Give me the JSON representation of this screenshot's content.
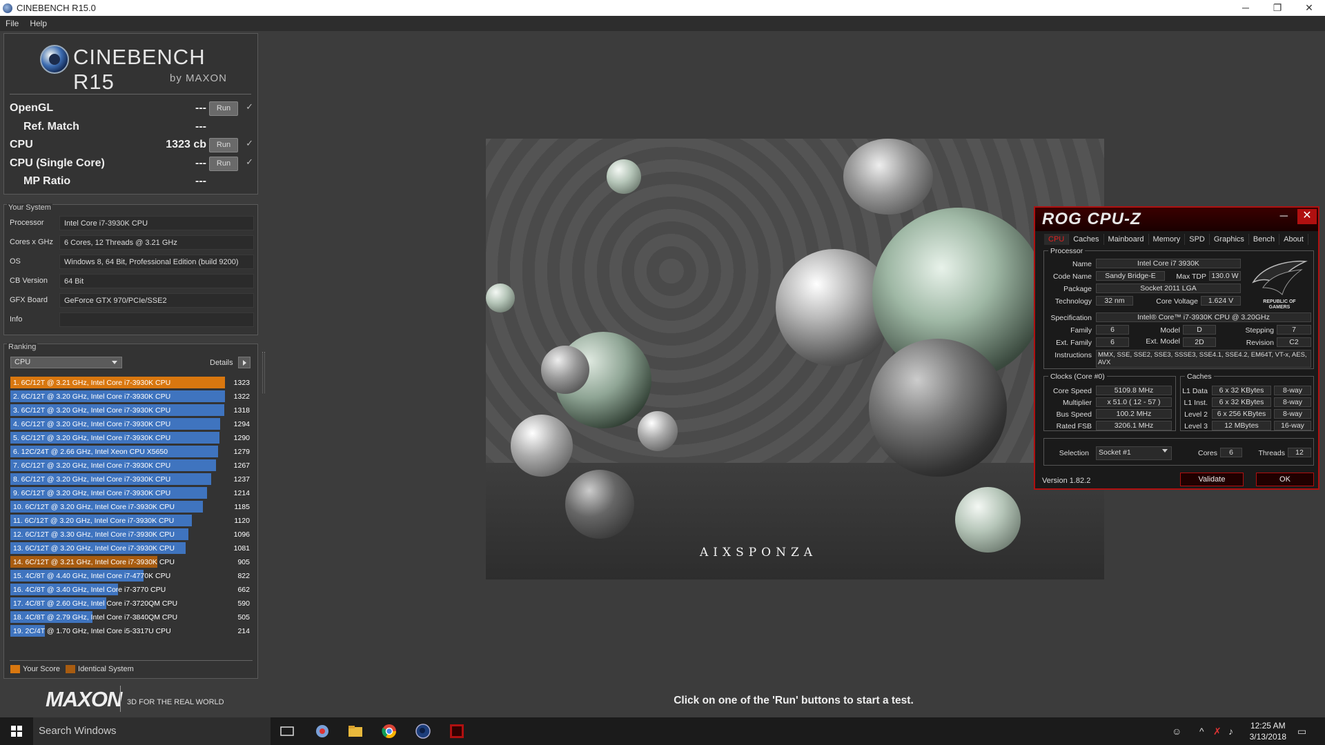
{
  "window": {
    "title": "CINEBENCH R15.0",
    "min": "─",
    "max": "❐",
    "close": "✕"
  },
  "menu": [
    "File",
    "Help"
  ],
  "logo": {
    "name": "CINEBENCH R15",
    "by": "by MAXON"
  },
  "benchmarks": [
    {
      "label": "OpenGL",
      "value": "---",
      "run": "Run",
      "check": "✓",
      "sub": false
    },
    {
      "label": "Ref. Match",
      "value": "---",
      "sub": true
    },
    {
      "label": "CPU",
      "value": "1323 cb",
      "run": "Run",
      "check": "✓",
      "sub": false
    },
    {
      "label": "CPU (Single Core)",
      "value": "---",
      "run": "Run",
      "check": "✓",
      "sub": false
    },
    {
      "label": "MP Ratio",
      "value": "---",
      "sub": true
    }
  ],
  "system": {
    "title": "Your System",
    "rows": [
      {
        "key": "Processor",
        "value": "Intel Core i7-3930K CPU"
      },
      {
        "key": "Cores x GHz",
        "value": "6 Cores, 12 Threads @ 3.21 GHz"
      },
      {
        "key": "OS",
        "value": "Windows 8, 64 Bit, Professional Edition (build 9200)"
      },
      {
        "key": "CB Version",
        "value": "64 Bit"
      },
      {
        "key": "GFX Board",
        "value": "GeForce GTX 970/PCIe/SSE2"
      },
      {
        "key": "Info",
        "value": ""
      }
    ]
  },
  "ranking": {
    "title": "Ranking",
    "selected": "CPU",
    "details": "Details",
    "max_score": 1323,
    "items": [
      {
        "label": "1. 6C/12T @ 3.21 GHz,  Intel Core i7-3930K CPU",
        "score": 1323,
        "kind": "your"
      },
      {
        "label": "2. 6C/12T @ 3.20 GHz,  Intel Core i7-3930K CPU",
        "score": 1322,
        "kind": "other"
      },
      {
        "label": "3. 6C/12T @ 3.20 GHz,  Intel Core i7-3930K CPU",
        "score": 1318,
        "kind": "other"
      },
      {
        "label": "4. 6C/12T @ 3.20 GHz,  Intel Core i7-3930K CPU",
        "score": 1294,
        "kind": "other"
      },
      {
        "label": "5. 6C/12T @ 3.20 GHz,  Intel Core i7-3930K CPU",
        "score": 1290,
        "kind": "other"
      },
      {
        "label": "6. 12C/24T @ 2.66 GHz, Intel Xeon CPU X5650",
        "score": 1279,
        "kind": "other"
      },
      {
        "label": "7. 6C/12T @ 3.20 GHz,  Intel Core i7-3930K CPU",
        "score": 1267,
        "kind": "other"
      },
      {
        "label": "8. 6C/12T @ 3.20 GHz,  Intel Core i7-3930K CPU",
        "score": 1237,
        "kind": "other"
      },
      {
        "label": "9. 6C/12T @ 3.20 GHz,  Intel Core i7-3930K CPU",
        "score": 1214,
        "kind": "other"
      },
      {
        "label": "10. 6C/12T @ 3.20 GHz,  Intel Core i7-3930K CPU",
        "score": 1185,
        "kind": "other"
      },
      {
        "label": "11. 6C/12T @ 3.20 GHz,  Intel Core i7-3930K CPU",
        "score": 1120,
        "kind": "other"
      },
      {
        "label": "12. 6C/12T @ 3.30 GHz,  Intel Core i7-3930K CPU",
        "score": 1096,
        "kind": "other"
      },
      {
        "label": "13. 6C/12T @ 3.20 GHz,  Intel Core i7-3930K CPU",
        "score": 1081,
        "kind": "other"
      },
      {
        "label": "14. 6C/12T @ 3.21 GHz,  Intel Core i7-3930K CPU",
        "score": 905,
        "kind": "identical"
      },
      {
        "label": "15. 4C/8T @ 4.40 GHz, Intel Core i7-4770K CPU",
        "score": 822,
        "kind": "other"
      },
      {
        "label": "16. 4C/8T @ 3.40 GHz,  Intel Core i7-3770 CPU",
        "score": 662,
        "kind": "other"
      },
      {
        "label": "17. 4C/8T @ 2.60 GHz, Intel Core i7-3720QM CPU",
        "score": 590,
        "kind": "other"
      },
      {
        "label": "18. 4C/8T @ 2.79 GHz,  Intel Core i7-3840QM CPU",
        "score": 505,
        "kind": "other"
      },
      {
        "label": "19. 2C/4T @ 1.70 GHz,  Intel Core i5-3317U CPU",
        "score": 214,
        "kind": "other"
      }
    ],
    "legend": {
      "your": "Your Score",
      "identical": "Identical System"
    }
  },
  "colors": {
    "your": "#d9770f",
    "identical": "#a85c10",
    "other": "#3f74bf"
  },
  "maxon": {
    "name": "MAXON",
    "tagline": "3D FOR THE REAL WORLD"
  },
  "status": "Click on one of the 'Run' buttons to start a test.",
  "render": {
    "brand": "AIXSPONZA"
  },
  "cpuz": {
    "title": "ROG CPU-Z",
    "tabs": [
      "CPU",
      "Caches",
      "Mainboard",
      "Memory",
      "SPD",
      "Graphics",
      "Bench",
      "About"
    ],
    "processor_label": "Processor",
    "name_k": "Name",
    "name": "Intel Core i7 3930K",
    "codename_k": "Code Name",
    "codename": "Sandy Bridge-E",
    "maxtdp_k": "Max TDP",
    "maxtdp": "130.0 W",
    "package_k": "Package",
    "package": "Socket 2011 LGA",
    "tech_k": "Technology",
    "tech": "32 nm",
    "voltage_k": "Core Voltage",
    "voltage": "1.624 V",
    "spec_k": "Specification",
    "spec": "Intel® Core™ i7-3930K CPU @ 3.20GHz",
    "family_k": "Family",
    "family": "6",
    "model_k": "Model",
    "model": "D",
    "stepping_k": "Stepping",
    "stepping": "7",
    "extfamily_k": "Ext. Family",
    "extfamily": "6",
    "extmodel_k": "Ext. Model",
    "extmodel": "2D",
    "revision_k": "Revision",
    "revision": "C2",
    "instr_k": "Instructions",
    "instr": "MMX, SSE, SSE2, SSE3, SSSE3, SSE4.1, SSE4.2, EM64T, VT-x, AES, AVX",
    "clocks_label": "Clocks (Core #0)",
    "corespeed_k": "Core Speed",
    "corespeed": "5109.8 MHz",
    "mult_k": "Multiplier",
    "mult": "x 51.0 ( 12 - 57 )",
    "bus_k": "Bus Speed",
    "bus": "100.2 MHz",
    "fsb_k": "Rated FSB",
    "fsb": "3206.1 MHz",
    "caches_label": "Caches",
    "l1d_k": "L1 Data",
    "l1d": "6 x 32 KBytes",
    "l1d_w": "8-way",
    "l1i_k": "L1 Inst.",
    "l1i": "6 x 32 KBytes",
    "l1i_w": "8-way",
    "l2_k": "Level 2",
    "l2": "6 x 256 KBytes",
    "l2_w": "8-way",
    "l3_k": "Level 3",
    "l3": "12 MBytes",
    "l3_w": "16-way",
    "selection_k": "Selection",
    "selection": "Socket #1",
    "cores_k": "Cores",
    "cores": "6",
    "threads_k": "Threads",
    "threads": "12",
    "version": "Version 1.82.2",
    "validate": "Validate",
    "ok": "OK",
    "rog_text": "REPUBLIC OF GAMERS"
  },
  "taskbar": {
    "search": "Search Windows",
    "time": "12:25 AM",
    "date": "3/13/2018"
  }
}
